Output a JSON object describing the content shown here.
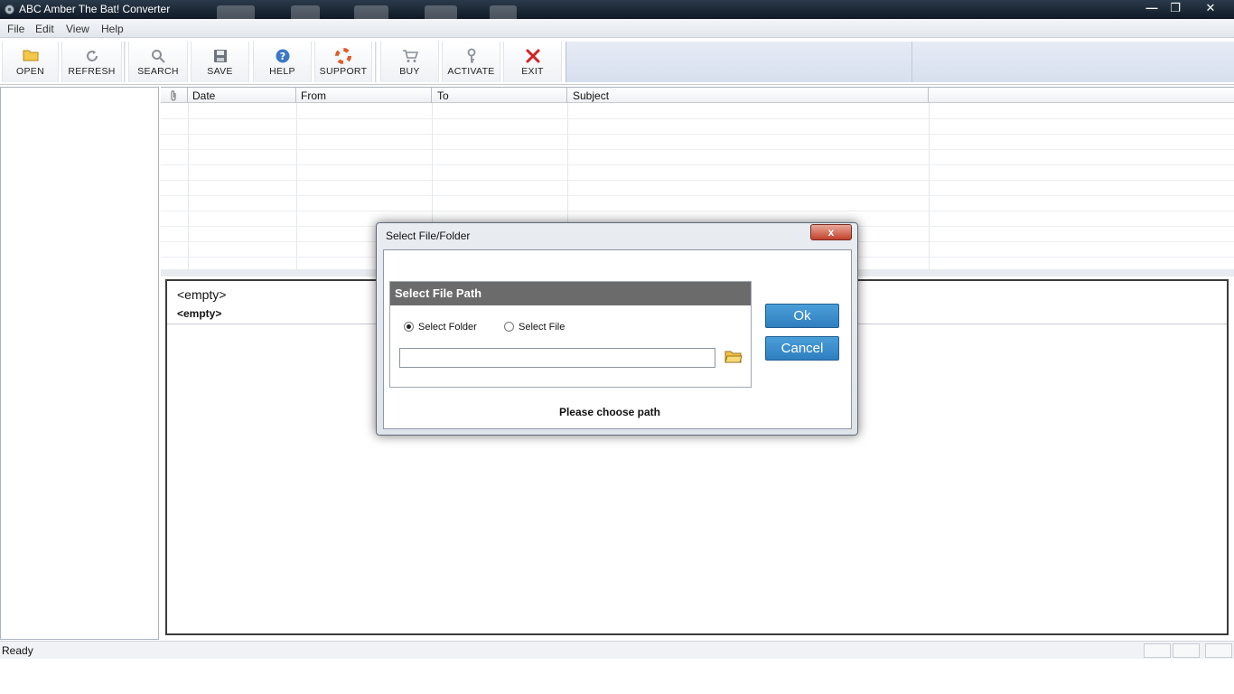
{
  "window": {
    "title": "ABC Amber The Bat! Converter"
  },
  "menu": [
    "File",
    "Edit",
    "View",
    "Help"
  ],
  "toolbar": {
    "open": "OPEN",
    "refresh": "REFRESH",
    "search": "SEARCH",
    "save": "SAVE",
    "help": "HELP",
    "support": "SUPPORT",
    "buy": "BUY",
    "activate": "ACTIVATE",
    "exit": "EXIT"
  },
  "grid": {
    "columns": [
      "Date",
      "From",
      "To",
      "Subject"
    ]
  },
  "preview": {
    "subject": "<empty>",
    "from": "<empty>"
  },
  "status": {
    "text": "Ready"
  },
  "dialog": {
    "title": "Select File/Folder",
    "close": "x",
    "group_title": "Select File Path",
    "radio_folder": "Select Folder",
    "radio_file": "Select File",
    "path_value": "",
    "ok": "Ok",
    "cancel": "Cancel",
    "message": "Please choose path"
  },
  "colors": {
    "accent_button": "#3a8cca",
    "exit_icon": "#d42020",
    "group_header": "#6b6b6b"
  }
}
